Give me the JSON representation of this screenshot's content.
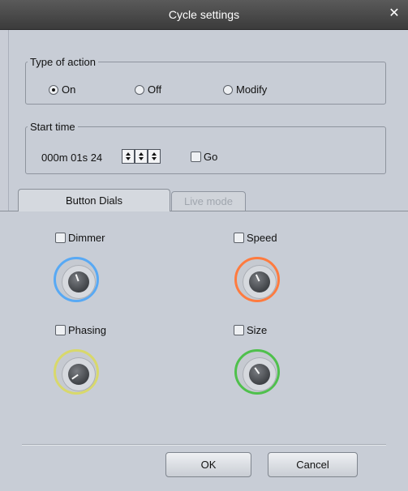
{
  "window": {
    "title": "Cycle settings"
  },
  "type_of_action": {
    "legend": "Type of action",
    "options": [
      {
        "label": "On",
        "checked": true
      },
      {
        "label": "Off",
        "checked": false
      },
      {
        "label": "Modify",
        "checked": false
      }
    ]
  },
  "start_time": {
    "legend": "Start time",
    "value": "000m 01s 24",
    "go_label": "Go",
    "go_checked": false
  },
  "tabs": [
    {
      "label": "Button Dials",
      "active": true
    },
    {
      "label": "Live mode",
      "active": false
    }
  ],
  "dials": [
    {
      "label": "Dimmer",
      "checked": false,
      "ring_color": "#58a9f4"
    },
    {
      "label": "Speed",
      "checked": false,
      "ring_color": "#ff7b3f"
    },
    {
      "label": "Phasing",
      "checked": false,
      "ring_color": "#d8d86b"
    },
    {
      "label": "Size",
      "checked": false,
      "ring_color": "#4fc04c"
    }
  ],
  "buttons": {
    "ok": "OK",
    "cancel": "Cancel"
  }
}
